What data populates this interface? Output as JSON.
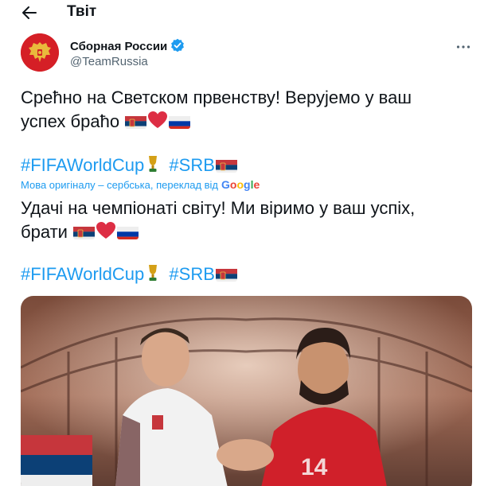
{
  "header": {
    "title": "Твіт",
    "back_icon": "arrow-left-icon"
  },
  "author": {
    "display_name": "Сборная России",
    "handle": "@TeamRussia",
    "verified_icon": "verified-badge-icon",
    "verified_color": "#1d9bf0",
    "more_icon": "more-horizontal-icon"
  },
  "tweet": {
    "original_line1": "Срећно на Светском првенству!  Верујемо у ваш",
    "original_line2": "успех браћо",
    "hashtag1": "#FIFAWorldCup",
    "hashtag2": "#SRB",
    "translation_note": "Мова оригіналу – сербська, переклад від",
    "translation_provider": {
      "g1": "G",
      "g2": "o",
      "g3": "o",
      "g4": "g",
      "g5": "l",
      "g6": "e"
    },
    "translated_line1": "Удачі на чемпіонаті світу! Ми віримо у ваш успіх,",
    "translated_line2": "брати",
    "emoji": [
      "serbia-flag-icon",
      "red-heart-icon",
      "russia-flag-icon",
      "trophy-icon"
    ]
  },
  "colors": {
    "link": "#1d9bf0",
    "text": "#0f1419",
    "secondary": "#536471"
  }
}
